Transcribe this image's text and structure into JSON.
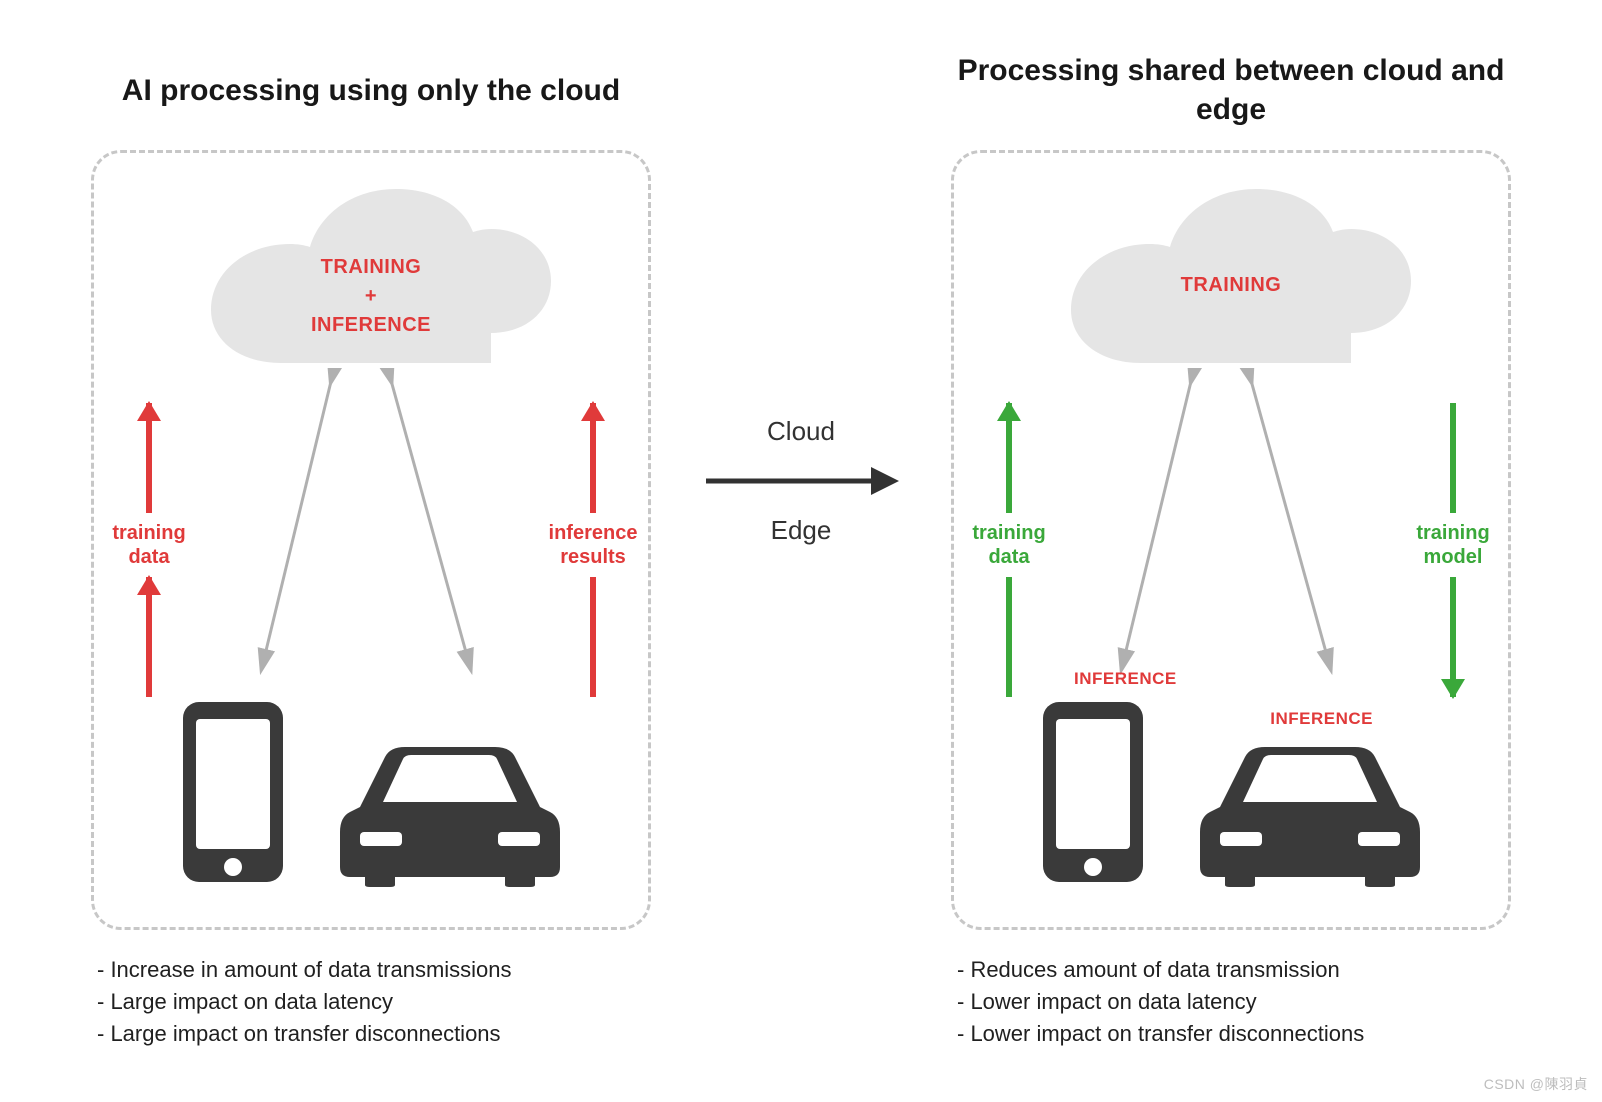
{
  "left": {
    "title": "AI processing using only the cloud",
    "cloud": {
      "line1": "TRAINING",
      "plus": "+",
      "line2": "INFERENCE"
    },
    "arrow_left": {
      "l1": "training",
      "l2": "data"
    },
    "arrow_right": {
      "l1": "inference",
      "l2": "results"
    },
    "bullets": [
      "- Increase in amount of data transmissions",
      "- Large impact on data latency",
      "- Large impact on transfer disconnections"
    ]
  },
  "right": {
    "title": "Processing shared between cloud and edge",
    "cloud": {
      "line1": "TRAINING"
    },
    "arrow_left": {
      "l1": "training",
      "l2": "data"
    },
    "arrow_right": {
      "l1": "training",
      "l2": "model"
    },
    "inference_label": "INFERENCE",
    "bullets": [
      "- Reduces amount of data transmission",
      "- Lower impact on data latency",
      "- Lower impact on transfer disconnections"
    ]
  },
  "middle": {
    "top": "Cloud",
    "bottom": "Edge"
  },
  "watermark": "CSDN @陳羽貞"
}
